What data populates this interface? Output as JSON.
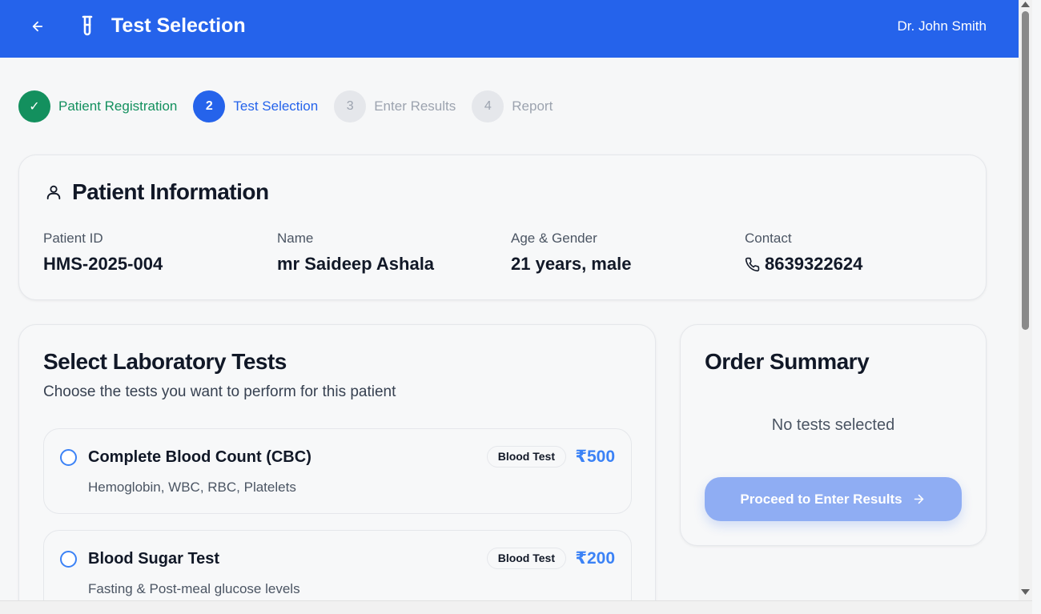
{
  "header": {
    "title": "Test Selection",
    "user": "Dr. John Smith",
    "back_icon": "arrow-left-icon",
    "brand_icon": "test-tube-icon",
    "bg_color": "#2563eb"
  },
  "stepper": {
    "steps": [
      {
        "number": "✓",
        "label": "Patient Registration",
        "state": "done"
      },
      {
        "number": "2",
        "label": "Test Selection",
        "state": "active"
      },
      {
        "number": "3",
        "label": "Enter Results",
        "state": "todo"
      },
      {
        "number": "4",
        "label": "Report",
        "state": "todo"
      }
    ]
  },
  "patient": {
    "title": "Patient Information",
    "fields": [
      {
        "label": "Patient ID",
        "value": "HMS-2025-004"
      },
      {
        "label": "Name",
        "value": "mr Saideep Ashala"
      },
      {
        "label": "Age & Gender",
        "value": "21 years, male"
      },
      {
        "label": "Contact",
        "value": "8639322624"
      }
    ]
  },
  "tests": {
    "title": "Select Laboratory Tests",
    "subtitle": "Choose the tests you want to perform for this patient",
    "items": [
      {
        "name": "Complete Blood Count (CBC)",
        "description": "Hemoglobin, WBC, RBC, Platelets",
        "category": "Blood Test",
        "price": "₹500",
        "selected": false
      },
      {
        "name": "Blood Sugar Test",
        "description": "Fasting & Post-meal glucose levels",
        "category": "Blood Test",
        "price": "₹200",
        "selected": false
      }
    ]
  },
  "summary": {
    "title": "Order Summary",
    "empty_text": "No tests selected",
    "proceed_label": "Proceed to Enter Results",
    "accent_color": "#3b82f6"
  }
}
